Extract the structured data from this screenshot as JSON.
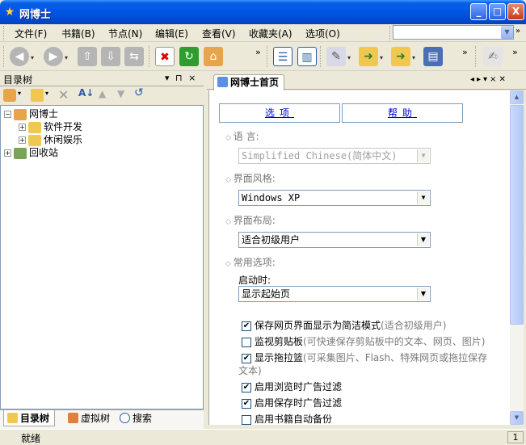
{
  "window": {
    "title": "网博士",
    "minimize": "_",
    "maximize": "□",
    "close": "X"
  },
  "menu": [
    "文件(F)",
    "书籍(B)",
    "节点(N)",
    "编辑(E)",
    "查看(V)",
    "收藏夹(A)",
    "选项(O)"
  ],
  "address": {
    "value": "",
    "more": "»"
  },
  "toolbar": {
    "overflow": "»"
  },
  "left_panel": {
    "title": "目录树",
    "controls": "▾ ⊓ ×",
    "tree": [
      {
        "label": "网博士",
        "expander": "−",
        "level": 0
      },
      {
        "label": "软件开发",
        "expander": "+",
        "level": 1
      },
      {
        "label": "休闲娱乐",
        "expander": "+",
        "level": 1
      },
      {
        "label": "回收站",
        "expander": "+",
        "level": 0
      }
    ],
    "tabs": [
      "目录树",
      "虚拟树",
      "搜索"
    ]
  },
  "document": {
    "tab_label": "网博士首页",
    "controls": "◂▸▾×✕",
    "option_tabs": [
      "选项",
      "帮助"
    ],
    "sections": {
      "language": {
        "label": "语 言:",
        "value": "Simplified Chinese(简体中文)"
      },
      "style": {
        "label": "界面风格:",
        "value": "Windows XP"
      },
      "layout": {
        "label": "界面布局:",
        "value": "适合初级用户"
      },
      "common": {
        "label": "常用选项:",
        "startup_label": "启动时:",
        "startup_value": "显示起始页"
      }
    },
    "checkboxes": [
      {
        "label": "保存网页界面显示为简洁模式",
        "hint": "(适合初级用户)",
        "checked": true
      },
      {
        "label": "监视剪贴板",
        "hint": "(可快速保存剪贴板中的文本、网页、图片)",
        "checked": false
      },
      {
        "label": "显示拖拉篮",
        "hint": "(可采集图片、Flash、特殊网页或拖拉保存",
        "checked": true
      },
      {
        "label": "",
        "hint": "文本)",
        "checked": null
      },
      {
        "label": "启用浏览时广告过滤",
        "hint": "",
        "checked": true
      },
      {
        "label": "启用保存时广告过滤",
        "hint": "",
        "checked": true
      },
      {
        "label": "启用书籍自动备份",
        "hint": "",
        "checked": false
      }
    ]
  },
  "status": {
    "text": "就绪",
    "panel": "1"
  },
  "colors": {
    "title_bar": "#0055e5",
    "chrome": "#ece9d8",
    "link": "#0000cc"
  }
}
